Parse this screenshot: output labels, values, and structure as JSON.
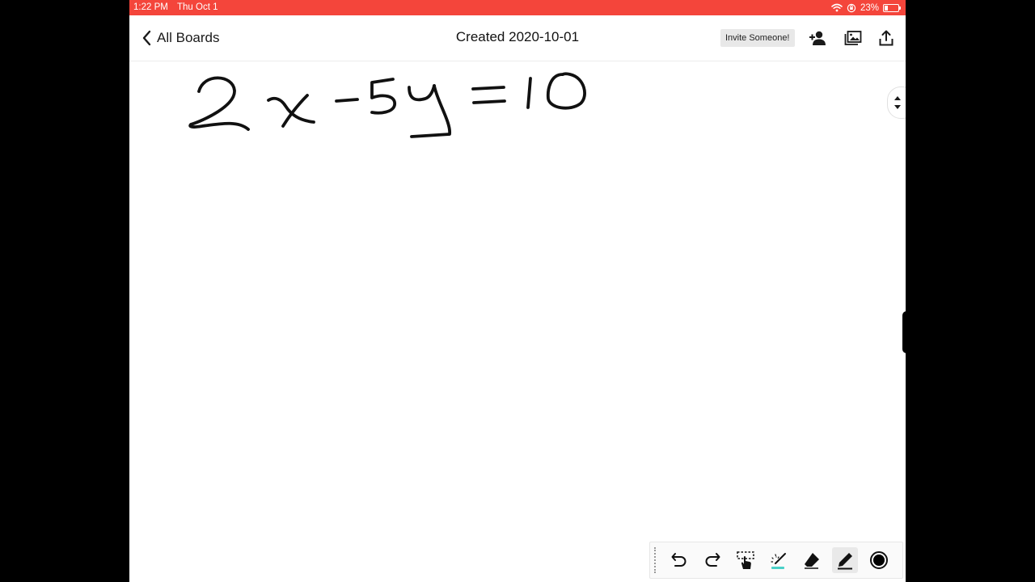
{
  "status_bar": {
    "time": "1:22 PM",
    "date": "Thu Oct 1",
    "battery_percent": "23%",
    "battery_level": 0.23,
    "icons": [
      "wifi-icon",
      "orientation-lock-icon",
      "battery-icon"
    ]
  },
  "nav": {
    "back_label": "All Boards",
    "title": "Created 2020-10-01",
    "invite_label": "Invite Someone!",
    "icons": [
      "add-person-icon",
      "gallery-icon",
      "share-icon"
    ]
  },
  "canvas": {
    "handwriting": "2x-5y=10",
    "ink_color": "#111111"
  },
  "toolbar": {
    "tools": [
      "undo-icon",
      "redo-icon",
      "hand-select-icon",
      "laser-pointer-icon",
      "eraser-icon",
      "pen-icon",
      "color-icon"
    ],
    "active_tool": "pen-icon",
    "selected_color": "#000000"
  },
  "colors": {
    "status_bar": "#f4453b",
    "background": "#ffffff",
    "letterbox": "#000000"
  }
}
